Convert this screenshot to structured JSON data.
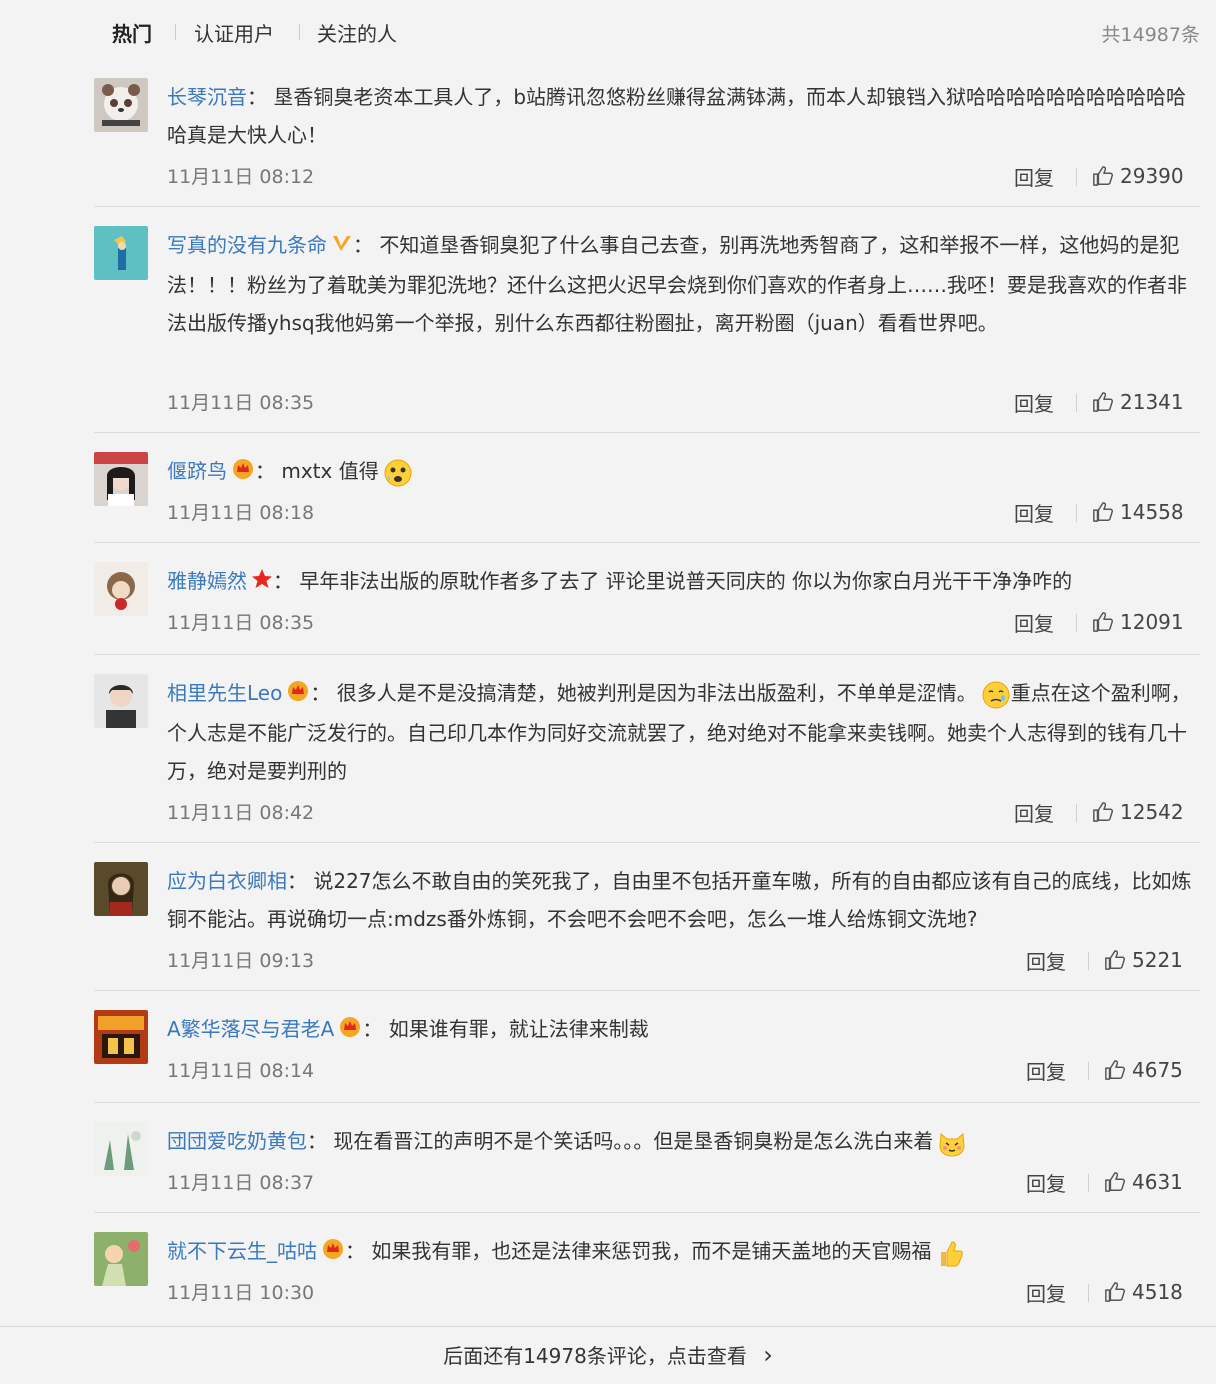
{
  "tabs": [
    "热门",
    "认证用户",
    "关注的人"
  ],
  "total": "共14987条",
  "reply_label": "回复",
  "comments": [
    {
      "user": "长琴沉音",
      "colon": "：",
      "text": "垦香铜臭老资本工具人了，b站腾讯忽悠粉丝赚得盆满钵满，而本人却锒铛入狱哈哈哈哈哈哈哈哈哈哈哈哈真是大快人心！",
      "time": "11月11日 08:12",
      "likes": "29390"
    },
    {
      "user": "写真的没有九条命",
      "colon": "：",
      "text": "不知道垦香铜臭犯了什么事自己去查，别再洗地秀智商了，这和举报不一样，这他妈的是犯法！！！粉丝为了着耽美为罪犯洗地？还什么这把火迟早会烧到你们喜欢的作者身上……我呸！要是我喜欢的作者非法出版传播yhsq我他妈第一个举报，别什么东西都往粉圈扯，离开粉圈（juan）看看世界吧。",
      "time": "11月11日 08:35",
      "likes": "21341"
    },
    {
      "user": "偃跻鸟",
      "colon": "：",
      "text": "mxtx 值得",
      "time": "11月11日 08:18",
      "likes": "14558"
    },
    {
      "user": "雅静嫣然",
      "colon": "：",
      "text": "早年非法出版的原耽作者多了去了 评论里说普天同庆的 你以为你家白月光干干净净咋的",
      "time": "11月11日 08:35",
      "likes": "12091"
    },
    {
      "user": "相里先生Leo",
      "colon": "：",
      "text": "很多人是不是没搞清楚，她被判刑是因为非法出版盈利，不单单是涩情。",
      "text2": "重点在这个盈利啊，个人志是不能广泛发行的。自己印几本作为同好交流就罢了，绝对绝对不能拿来卖钱啊。她卖个人志得到的钱有几十万，绝对是要判刑的",
      "time": "11月11日 08:42",
      "likes": "12542"
    },
    {
      "user": "应为白衣卿相",
      "colon": "：",
      "text": "说227怎么不敢自由的笑死我了，自由里不包括开童车嗷，所有的自由都应该有自己的底线，比如炼铜不能沾。再说确切一点:mdzs番外炼铜，不会吧不会吧不会吧，怎么一堆人给炼铜文洗地?",
      "time": "11月11日 09:13",
      "likes": "5221"
    },
    {
      "user": "A繁华落尽与君老A",
      "colon": "：",
      "text": "如果谁有罪，就让法律来制裁",
      "time": "11月11日 08:14",
      "likes": "4675"
    },
    {
      "user": "団団爱吃奶黄包",
      "colon": "：",
      "text": "现在看晋江的声明不是个笑话吗。。。但是垦香铜臭粉是怎么洗白来着",
      "time": "11月11日 08:37",
      "likes": "4631"
    },
    {
      "user": "就不下云生_咕咕",
      "colon": "：",
      "text": "如果我有罪，也还是法律来惩罚我，而不是铺天盖地的天官赐福",
      "time": "11月11日 10:30",
      "likes": "4518"
    }
  ],
  "footer": {
    "text": "后面还有14978条评论，点击查看",
    "arrow": "›"
  },
  "colors": {
    "username": "#3a79bc",
    "background": "#f3f3f3",
    "divider": "#dcdcdc",
    "vip_gold": "#f5a623"
  }
}
